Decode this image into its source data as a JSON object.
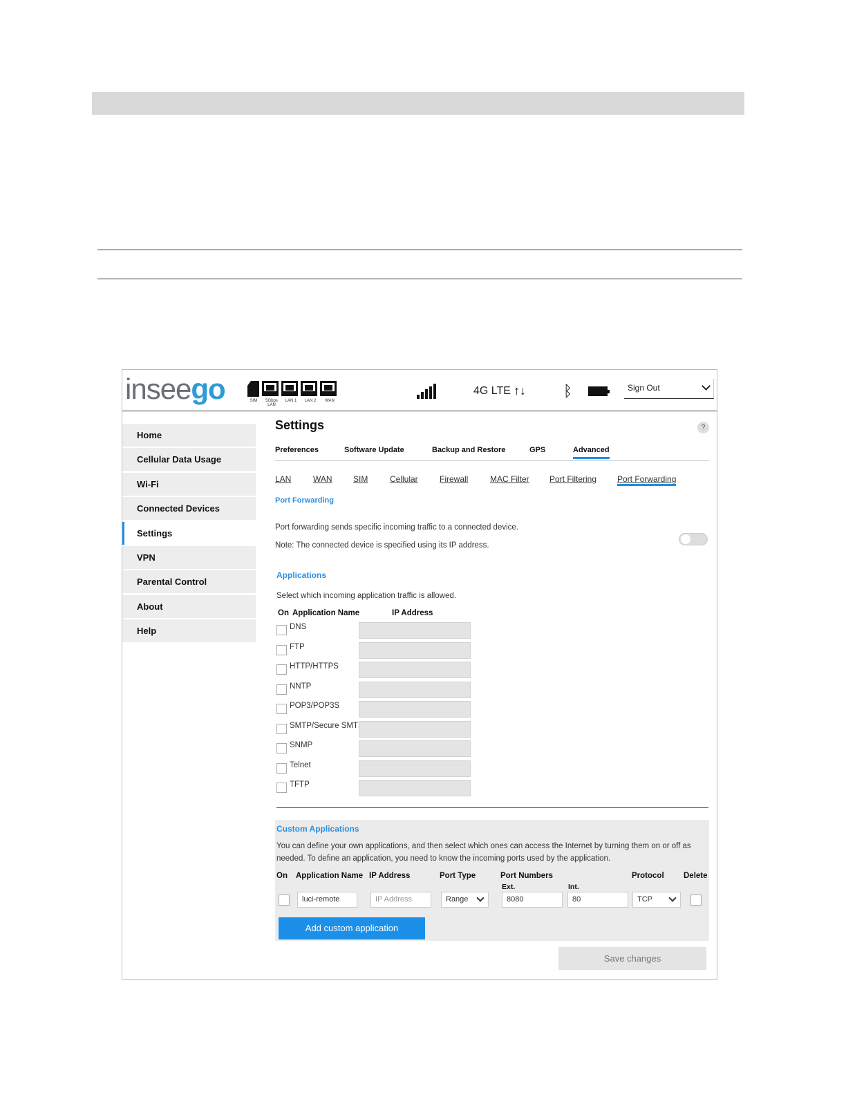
{
  "header": {
    "logo_main": "insee",
    "logo_accent": "go",
    "status_labels": [
      "SIM",
      "5Gbps LAN",
      "LAN 1",
      "LAN 2",
      "WAN"
    ],
    "network": "4G LTE",
    "signout": "Sign Out"
  },
  "sidebar": {
    "items": [
      {
        "label": "Home"
      },
      {
        "label": "Cellular Data Usage"
      },
      {
        "label": "Wi-Fi"
      },
      {
        "label": "Connected Devices"
      },
      {
        "label": "Settings"
      },
      {
        "label": "VPN"
      },
      {
        "label": "Parental Control"
      },
      {
        "label": "About"
      },
      {
        "label": "Help"
      }
    ],
    "active": "Settings"
  },
  "main": {
    "title": "Settings",
    "help": "?",
    "tabs": [
      "Preferences",
      "Software Update",
      "Backup and Restore",
      "GPS",
      "Advanced"
    ],
    "active_tab": "Advanced",
    "subtabs": [
      "LAN",
      "WAN",
      "SIM",
      "Cellular",
      "Firewall",
      "MAC Filter",
      "Port Filtering",
      "Port Forwarding"
    ],
    "active_subtab": "Port Forwarding",
    "section_title": "Port Forwarding",
    "desc1": "Port forwarding sends specific incoming traffic to a connected device.",
    "desc2": "Note: The connected device is specified using its IP address.",
    "toggle_on": false,
    "applications": {
      "title": "Applications",
      "desc": "Select which incoming application traffic is allowed.",
      "col_on": "On",
      "col_name": "Application Name",
      "col_ip": "IP Address",
      "rows": [
        "DNS",
        "FTP",
        "HTTP/HTTPS",
        "NNTP",
        "POP3/POP3S",
        "SMTP/Secure SMTP",
        "SNMP",
        "Telnet",
        "TFTP"
      ]
    },
    "custom": {
      "title": "Custom Applications",
      "desc1": "You can define your own applications, and then select which ones can access the Internet by turning them on or off as",
      "desc2": "needed. To define an application, you need to know the incoming ports used by the application.",
      "col_on": "On",
      "col_name": "Application Name",
      "col_ip": "IP Address",
      "col_port_type": "Port Type",
      "col_port_numbers": "Port Numbers",
      "col_ext": "Ext.",
      "col_int": "Int.",
      "col_protocol": "Protocol",
      "col_delete": "Delete",
      "row": {
        "name": "luci-remote",
        "ip_placeholder": "IP Address",
        "port_type": "Range",
        "ext": "8080",
        "int": "80",
        "protocol": "TCP"
      },
      "add_button": "Add custom application"
    },
    "save_button": "Save changes"
  }
}
